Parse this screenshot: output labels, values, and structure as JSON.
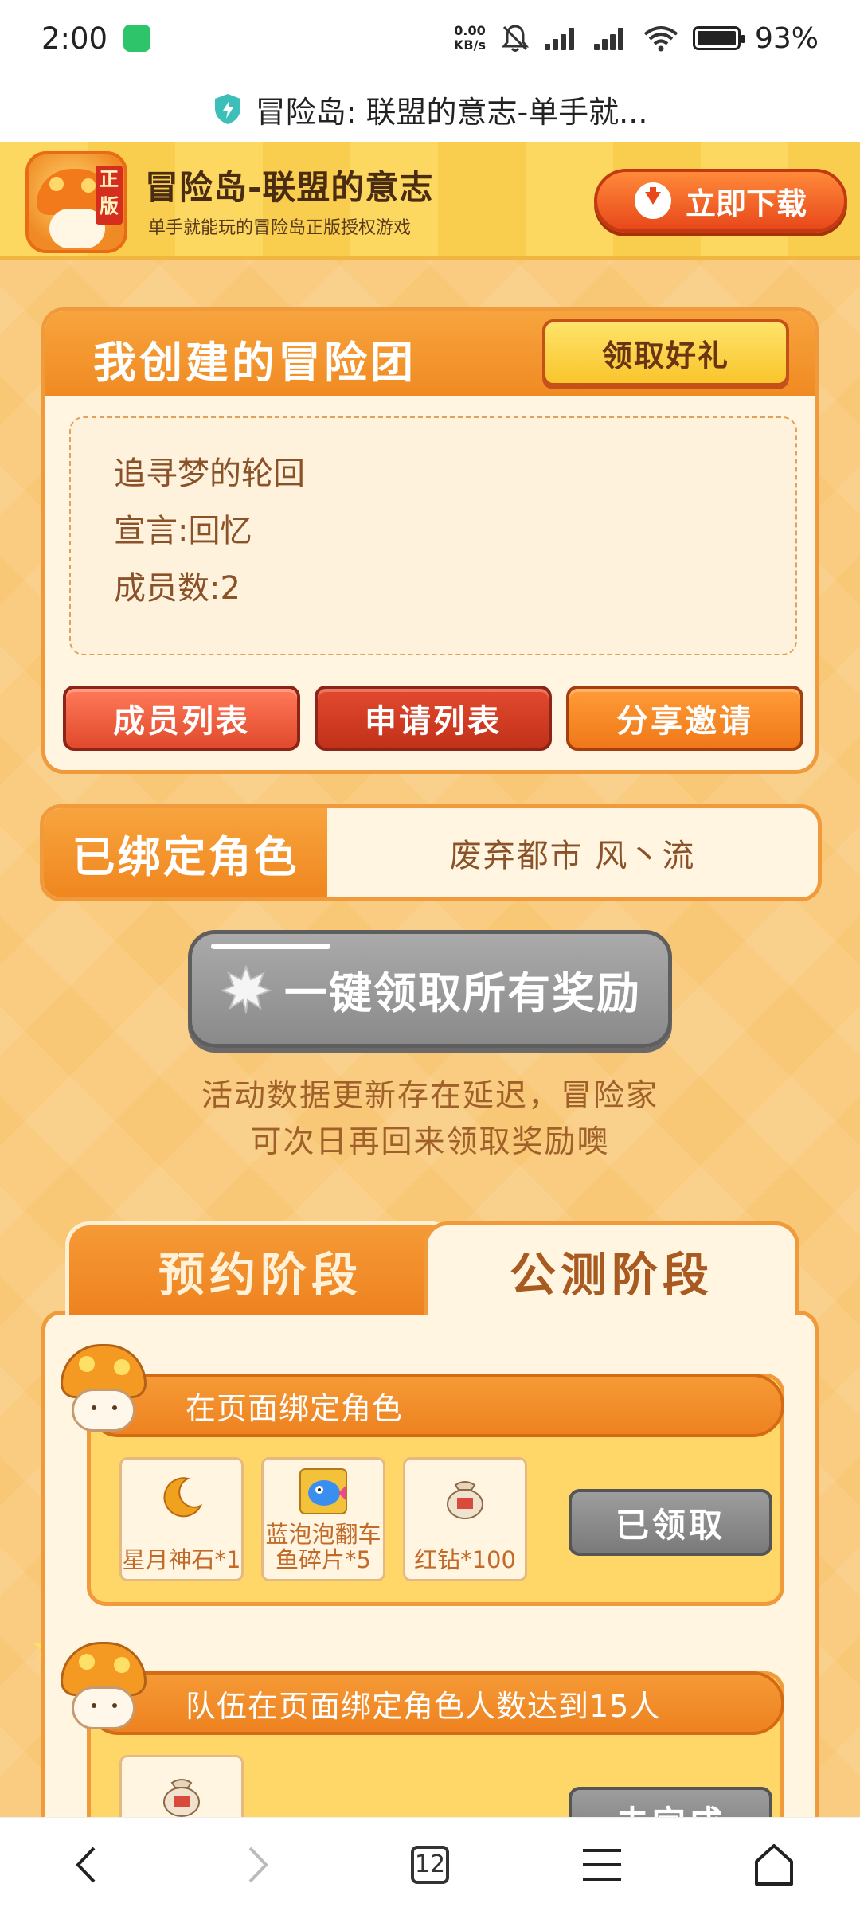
{
  "status_bar": {
    "time": "2:00",
    "net_speed_value": "0.00",
    "net_speed_unit": "KB/s",
    "battery": "93%"
  },
  "browser": {
    "page_title": "冒险岛: 联盟的意志-单手就..."
  },
  "banner": {
    "app_title": "冒险岛-联盟的意志",
    "app_subtitle": "单手就能玩的冒险岛正版授权游戏",
    "logo_badge": "正版",
    "download_label": "立即下载"
  },
  "team": {
    "header": "我创建的冒险团",
    "gift_button": "领取好礼",
    "name": "追寻梦的轮回",
    "declaration": "宣言:回忆",
    "members": "成员数:2",
    "buttons": [
      "成员列表",
      "申请列表",
      "分享邀请"
    ]
  },
  "bound_role": {
    "label": "已绑定角色",
    "value": "废弃都市 风丶流"
  },
  "claim_all": {
    "label": "一键领取所有奖励"
  },
  "notice": {
    "line1": "活动数据更新存在延迟，冒险家",
    "line2": "可次日再回来领取奖励噢"
  },
  "stage_tabs": [
    {
      "label": "预约阶段",
      "active": false
    },
    {
      "label": "公测阶段",
      "active": true
    }
  ],
  "tasks": [
    {
      "title": "在页面绑定角色",
      "rewards": [
        {
          "icon": "moon-stone-icon",
          "label": "星月神石*1"
        },
        {
          "icon": "fish-fragment-icon",
          "label": "蓝泡泡翻车鱼碎片*5"
        },
        {
          "icon": "red-diamond-bag-icon",
          "label": "红钻*100"
        }
      ],
      "status": "已领取"
    },
    {
      "title": "队伍在页面绑定角色人数达到15人",
      "rewards": [
        {
          "icon": "red-diamond-bag-icon",
          "label": ""
        }
      ],
      "status": "未完成"
    }
  ],
  "nav": {
    "tab_count": "12"
  },
  "colors": {
    "accent_orange": "#f18a22",
    "background": "#f9c877",
    "disabled_gray": "#8a8a8a",
    "download_red": "#e8481a"
  }
}
